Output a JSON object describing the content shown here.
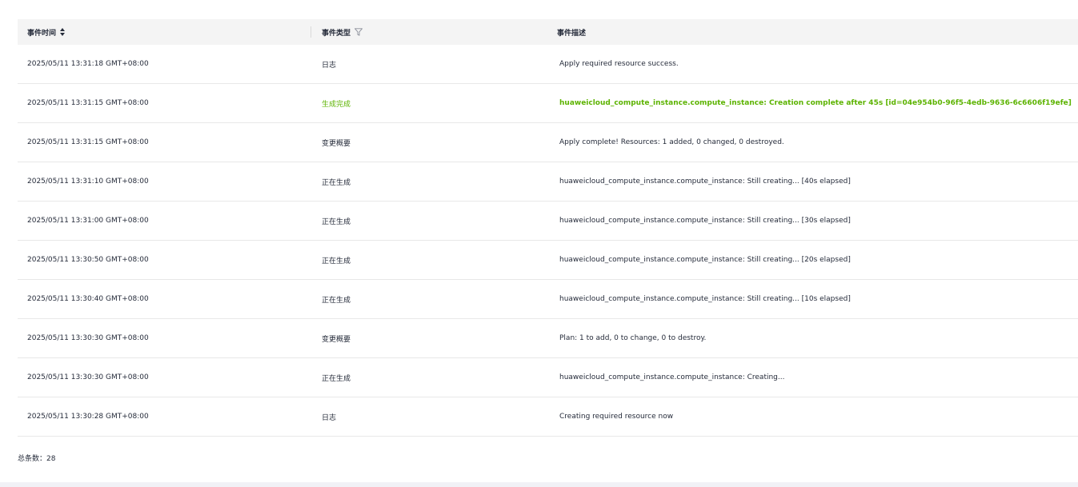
{
  "table": {
    "headers": {
      "time": "事件时间",
      "type": "事件类型",
      "desc": "事件描述"
    },
    "rows": [
      {
        "time": "2025/05/11 13:31:18 GMT+08:00",
        "type": "日志",
        "desc": "Apply required resource success.",
        "status": "normal"
      },
      {
        "time": "2025/05/11 13:31:15 GMT+08:00",
        "type": "生成完成",
        "desc": "huaweicloud_compute_instance.compute_instance: Creation complete after 45s [id=04e954b0-96f5-4edb-9636-6c6606f19efe]",
        "status": "success"
      },
      {
        "time": "2025/05/11 13:31:15 GMT+08:00",
        "type": "变更概要",
        "desc": "Apply complete! Resources: 1 added, 0 changed, 0 destroyed.",
        "status": "normal"
      },
      {
        "time": "2025/05/11 13:31:10 GMT+08:00",
        "type": "正在生成",
        "desc": "huaweicloud_compute_instance.compute_instance: Still creating... [40s elapsed]",
        "status": "normal"
      },
      {
        "time": "2025/05/11 13:31:00 GMT+08:00",
        "type": "正在生成",
        "desc": "huaweicloud_compute_instance.compute_instance: Still creating... [30s elapsed]",
        "status": "normal"
      },
      {
        "time": "2025/05/11 13:30:50 GMT+08:00",
        "type": "正在生成",
        "desc": "huaweicloud_compute_instance.compute_instance: Still creating... [20s elapsed]",
        "status": "normal"
      },
      {
        "time": "2025/05/11 13:30:40 GMT+08:00",
        "type": "正在生成",
        "desc": "huaweicloud_compute_instance.compute_instance: Still creating... [10s elapsed]",
        "status": "normal"
      },
      {
        "time": "2025/05/11 13:30:30 GMT+08:00",
        "type": "变更概要",
        "desc": "Plan: 1 to add, 0 to change, 0 to destroy.",
        "status": "normal"
      },
      {
        "time": "2025/05/11 13:30:30 GMT+08:00",
        "type": "正在生成",
        "desc": "huaweicloud_compute_instance.compute_instance: Creating...",
        "status": "normal"
      },
      {
        "time": "2025/05/11 13:30:28 GMT+08:00",
        "type": "日志",
        "desc": "Creating required resource now",
        "status": "normal"
      }
    ]
  },
  "footer": {
    "total_label": "总条数：28"
  },
  "colors": {
    "success": "#5cb300",
    "header_bg": "#f4f4f4",
    "text": "#252b3a"
  },
  "icons": {
    "sort": "sort-icon",
    "filter": "filter-icon"
  }
}
